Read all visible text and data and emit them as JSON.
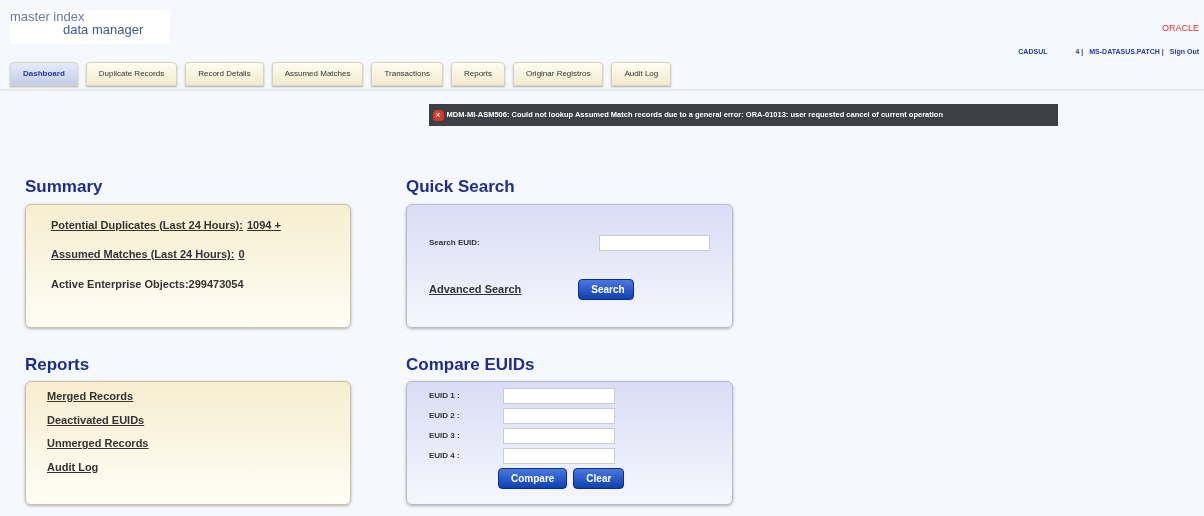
{
  "logo": {
    "line_1": "master index",
    "line_2": "data manager"
  },
  "brand": "ORACLE",
  "user_bar": [
    "CADSUL",
    "4 |",
    "MS-DATASUS.PATCH |",
    "Sign Out"
  ],
  "tabs": [
    {
      "label": "Dashboard",
      "selected": true
    },
    {
      "label": "Duplicate Records",
      "selected": false
    },
    {
      "label": "Record Details",
      "selected": false
    },
    {
      "label": "Assumed Matches",
      "selected": false
    },
    {
      "label": "Transactions",
      "selected": false
    },
    {
      "label": "Reports",
      "selected": false
    },
    {
      "label": "Originar Registros",
      "selected": false
    },
    {
      "label": "Audit Log",
      "selected": false
    }
  ],
  "error": {
    "icon": "×",
    "message": "MDM-MI-ASM506: Could not lookup Assumed Match records due to a general error: ORA-01013: user requested cancel of current operation"
  },
  "summary": {
    "title": "Summary",
    "rows": [
      {
        "kind": "link",
        "label": "Potential Duplicates (Last 24 Hours):",
        "value": "1094 +"
      },
      {
        "kind": "link",
        "label": "Assumed Matches (Last 24 Hours):",
        "value": "0"
      },
      {
        "kind": "text",
        "label": "Active Enterprise Objects:299473054"
      }
    ]
  },
  "quick_search": {
    "title": "Quick Search",
    "field_label": "Search EUID:",
    "link": "Advanced Search",
    "button": "Search"
  },
  "reports": {
    "title": "Reports",
    "links": [
      "Merged Records",
      "Deactivated EUIDs",
      "Unmerged Records",
      "Audit Log"
    ]
  },
  "compare": {
    "title": "Compare EUIDs",
    "fields": [
      "EUID 1 :",
      "EUID 2 :",
      "EUID 3 :",
      "EUID 4 :"
    ],
    "buttons": [
      "Compare",
      "Clear"
    ]
  }
}
